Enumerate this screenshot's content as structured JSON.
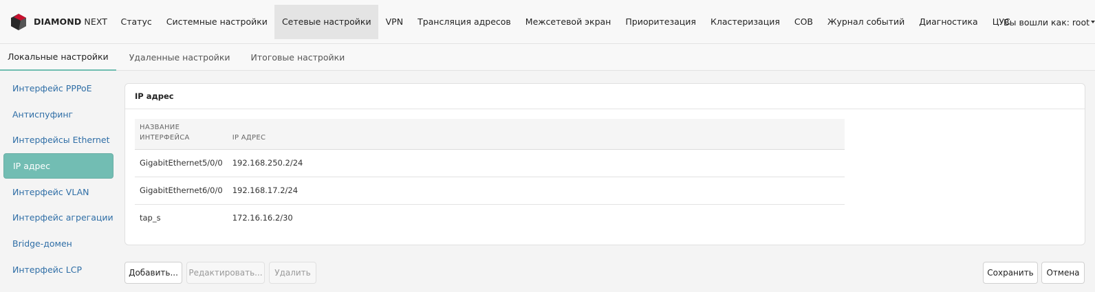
{
  "brand": {
    "name_bold": "DIAMOND",
    "name_rest": " NEXT"
  },
  "nav": {
    "items": [
      {
        "label": "Статус"
      },
      {
        "label": "Системные настройки"
      },
      {
        "label": "Сетевые настройки",
        "active": true
      },
      {
        "label": "VPN"
      },
      {
        "label": "Трансляция адресов"
      },
      {
        "label": "Межсетевой экран"
      },
      {
        "label": "Приоритезация"
      },
      {
        "label": "Кластеризация"
      },
      {
        "label": "СОВ"
      },
      {
        "label": "Журнал событий"
      },
      {
        "label": "Диагностика"
      },
      {
        "label": "ЦУС"
      }
    ],
    "user_label": "Вы вошли как: root"
  },
  "subtabs": [
    {
      "label": "Локальные настройки",
      "active": true
    },
    {
      "label": "Удаленные настройки"
    },
    {
      "label": "Итоговые настройки"
    }
  ],
  "sidebar": {
    "items": [
      {
        "label": "Интерфейс PPPoE"
      },
      {
        "label": "Антиспуфинг"
      },
      {
        "label": "Интерфейсы Ethernet"
      },
      {
        "label": "IP адрес",
        "active": true
      },
      {
        "label": "Интерфейс VLAN"
      },
      {
        "label": "Интерфейс агрегации"
      },
      {
        "label": "Bridge-домен"
      },
      {
        "label": "Интерфейс LCP"
      }
    ]
  },
  "panel": {
    "title": "IP адрес",
    "columns": {
      "name_line1": "НАЗВАНИЕ",
      "name_line2": "ИНТЕРФЕЙСА",
      "ip": "IP АДРЕС"
    },
    "rows": [
      {
        "name": "GigabitEthernet5/0/0",
        "ip": "192.168.250.2/24"
      },
      {
        "name": "GigabitEthernet6/0/0",
        "ip": "192.168.17.2/24"
      },
      {
        "name": "tap_s",
        "ip": "172.16.16.2/30"
      }
    ]
  },
  "actions": {
    "add": "Добавить...",
    "edit": "Редактировать...",
    "delete": "Удалить",
    "save": "Сохранить",
    "cancel": "Отмена"
  },
  "colors": {
    "accent": "#72bdb3",
    "link": "#2f6ea6",
    "logo_red": "#c8102e",
    "logo_dark": "#3a3a3a"
  }
}
